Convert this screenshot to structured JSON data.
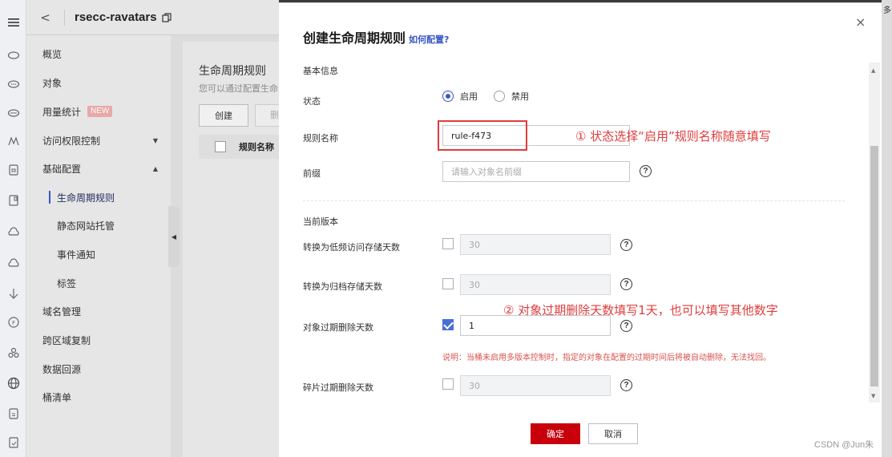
{
  "header": {
    "back_symbol": "<",
    "bucket_name": "rsecc-ravatars"
  },
  "sidebar": {
    "items": [
      {
        "label": "概览"
      },
      {
        "label": "对象"
      },
      {
        "label": "用量统计",
        "badge": "NEW"
      },
      {
        "label": "访问权限控制"
      },
      {
        "label": "基础配置"
      },
      {
        "label": "生命周期规则"
      },
      {
        "label": "静态网站托管"
      },
      {
        "label": "事件通知"
      },
      {
        "label": "标签"
      },
      {
        "label": "域名管理"
      },
      {
        "label": "跨区域复制"
      },
      {
        "label": "数据回源"
      },
      {
        "label": "桶清单"
      }
    ]
  },
  "rail_icons": [
    "menu-icon",
    "cloud-icon",
    "cloud-icon",
    "cloud-icon",
    "person-icon",
    "document-icon",
    "document-icon",
    "cloud-icon",
    "cloud-icon",
    "anchor-icon",
    "circle-icon",
    "link-icon",
    "globe-icon",
    "document-icon",
    "document-icon"
  ],
  "content": {
    "title": "生命周期规则",
    "desc": "您可以通过配置生命",
    "create_btn": "创建",
    "delete_btn": "删",
    "col_rule_name": "规则名称"
  },
  "dialog": {
    "title": "创建生命周期规则",
    "help_link": "如何配置?",
    "close": "×",
    "section_basic": "基本信息",
    "status_label": "状态",
    "status_enable": "启用",
    "status_disable": "禁用",
    "rule_name_label": "规则名称",
    "rule_name_value": "rule-f473",
    "prefix_label": "前缀",
    "prefix_placeholder": "请输入对象名前缀",
    "section_current": "当前版本",
    "to_ia_label": "转换为低频访问存储天数",
    "to_ia_value": "30",
    "to_archive_label": "转换为归档存储天数",
    "to_archive_value": "30",
    "expire_label": "对象过期删除天数",
    "expire_value": "1",
    "note": "说明：当桶未启用多版本控制时，指定的对象在配置的过期时间后将被自动删除，无法找回。",
    "fragment_label": "碎片过期删除天数",
    "fragment_value": "30",
    "ok": "确定",
    "cancel": "取消",
    "help_q": "?"
  },
  "annotations": {
    "a1": "① 状态选择“启用”规则名称随意填写",
    "a2": "② 对象过期删除天数填写1天，也可以填写其他数字"
  },
  "right_edge_text": "多",
  "watermark": "CSDN @Jun朱"
}
